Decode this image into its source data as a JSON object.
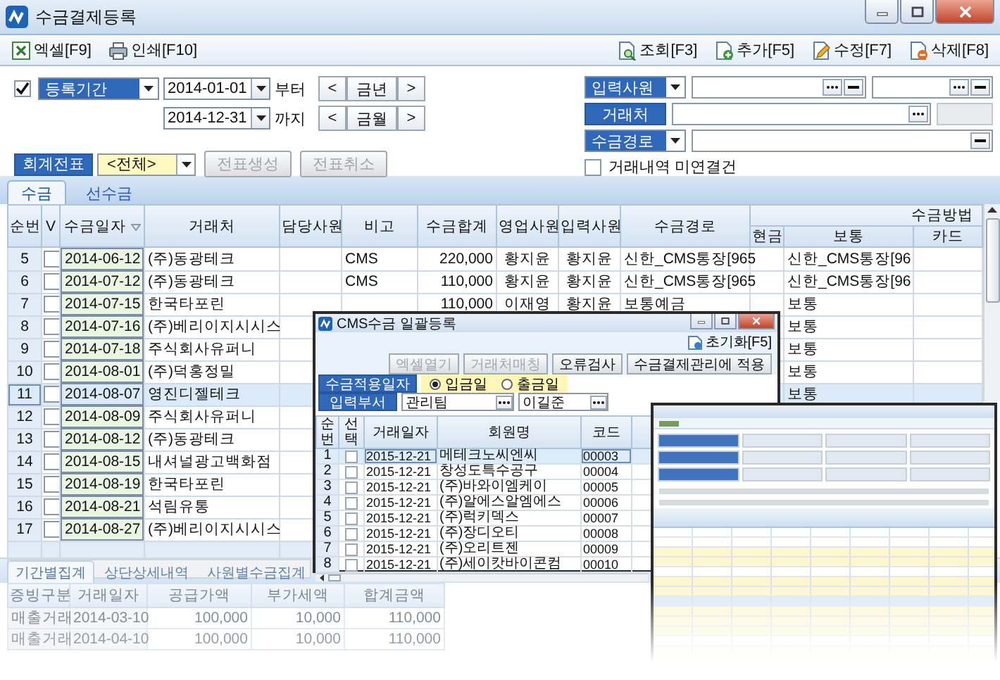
{
  "window": {
    "title": "수금결제등록"
  },
  "toolbar": {
    "left": [
      {
        "kind": "excel",
        "label": "엑셀[F9]"
      },
      {
        "kind": "print",
        "label": "인쇄[F10]"
      }
    ],
    "right": [
      {
        "kind": "search",
        "label": "조회[F3]"
      },
      {
        "kind": "add",
        "label": "추가[F5]"
      },
      {
        "kind": "edit",
        "label": "수정[F7]"
      },
      {
        "kind": "delete",
        "label": "삭제[F8]"
      }
    ]
  },
  "period": {
    "checked": true,
    "label": "등록기간",
    "from": "2014-01-01",
    "from_suffix": "부터",
    "to": "2014-12-31",
    "to_suffix": "까지",
    "year_nav": [
      "<",
      "금년",
      ">"
    ],
    "month_nav": [
      "<",
      "금월",
      ">"
    ]
  },
  "voucher": {
    "label": "회계전표",
    "value": "<전체>",
    "buttons": [
      {
        "label": "전표생성",
        "disabled": true
      },
      {
        "label": "전표취소",
        "disabled": true
      }
    ]
  },
  "staff": {
    "label": "입력사원"
  },
  "client": {
    "label": "거래처"
  },
  "route": {
    "label": "수금경로"
  },
  "unlinked": {
    "label": "거래내역 미연결건",
    "checked": false
  },
  "tabs": [
    {
      "label": "수금",
      "selected": true
    },
    {
      "label": "선수금",
      "selected": false
    }
  ],
  "grid": {
    "columns": [
      "순번",
      "V",
      "수금일자",
      "거래처",
      "담당사원",
      "비고",
      "수금합계",
      "영업사원",
      "입력사원",
      "수금경로"
    ],
    "method_group": {
      "label": "수금방법",
      "columns": [
        "현금",
        "보통",
        "카드"
      ]
    },
    "rows": [
      {
        "no": "5",
        "checked": false,
        "selected": false,
        "date": "2014-06-12",
        "client": "(주)동광테크",
        "memo": "CMS",
        "total": "220,000",
        "sales": "황지윤",
        "entry": "황지윤",
        "route": "신한_CMS통장[965",
        "ordinary": "신한_CMS통장[96"
      },
      {
        "no": "6",
        "checked": false,
        "selected": false,
        "date": "2014-07-12",
        "client": "(주)동광테크",
        "memo": "CMS",
        "total": "110,000",
        "sales": "황지윤",
        "entry": "황지윤",
        "route": "신한_CMS통장[965",
        "ordinary": "신한_CMS통장[96"
      },
      {
        "no": "7",
        "checked": false,
        "selected": false,
        "date": "2014-07-15",
        "client": "한국타포린",
        "total": "110,000",
        "sales": "이재영",
        "entry": "황지윤",
        "route": "보통예금",
        "ordinary": "보통"
      },
      {
        "no": "8",
        "checked": false,
        "selected": false,
        "date": "2014-07-16",
        "client": "(주)베리이지시시스",
        "ordinary": "보통"
      },
      {
        "no": "9",
        "checked": false,
        "selected": false,
        "date": "2014-07-18",
        "client": "주식회사유퍼니",
        "ordinary": "보통"
      },
      {
        "no": "10",
        "checked": false,
        "selected": false,
        "date": "2014-08-01",
        "client": "(주)덕홍정밀",
        "ordinary": "보통"
      },
      {
        "no": "11",
        "checked": false,
        "selected": true,
        "date": "2014-08-07",
        "client": "영진디젤테크",
        "ordinary": "보통"
      },
      {
        "no": "12",
        "checked": false,
        "selected": false,
        "date": "2014-08-09",
        "client": "주식회사유퍼니"
      },
      {
        "no": "13",
        "checked": false,
        "selected": false,
        "date": "2014-08-12",
        "client": "(주)동광테크"
      },
      {
        "no": "14",
        "checked": false,
        "selected": false,
        "date": "2014-08-15",
        "client": "내셔널광고백화점"
      },
      {
        "no": "15",
        "checked": false,
        "selected": false,
        "date": "2014-08-19",
        "client": "한국타포린"
      },
      {
        "no": "16",
        "checked": false,
        "selected": false,
        "date": "2014-08-21",
        "client": "석림유통"
      },
      {
        "no": "17",
        "checked": false,
        "selected": false,
        "date": "2014-08-27",
        "client": "(주)베리이지시시스"
      }
    ]
  },
  "summary_tabs": [
    {
      "label": "기간별집계",
      "selected": true
    },
    {
      "label": "상단상세내역",
      "selected": false
    },
    {
      "label": "사원별수금집계",
      "selected": false
    }
  ],
  "summary": {
    "columns": [
      "증빙구분",
      "거래일자",
      "공급가액",
      "부가세액",
      "합계금액"
    ],
    "rows": [
      [
        "매출거래",
        "2014-03-10",
        "100,000",
        "10,000",
        "110,000"
      ],
      [
        "매출거래",
        "2014-04-10",
        "100,000",
        "10,000",
        "110,000"
      ]
    ]
  },
  "cms_dialog": {
    "title": "CMS수금 일괄등록",
    "reset": "초기화[F5]",
    "buttons": [
      {
        "label": "엑셀열기",
        "disabled": true
      },
      {
        "label": "거래처매칭",
        "disabled": true
      },
      {
        "label": "오류검사",
        "disabled": false
      },
      {
        "label": "수금결제관리에 적용",
        "disabled": false
      }
    ],
    "date_type": {
      "label": "수금적용일자",
      "options": [
        {
          "label": "입금일",
          "selected": true
        },
        {
          "label": "출금일",
          "selected": false
        }
      ]
    },
    "dept": {
      "label": "입력부서",
      "value": "관리팀",
      "person": "이길준"
    },
    "columns": [
      "순번",
      "선택",
      "거래일자",
      "회원명",
      "코드"
    ],
    "rows": [
      {
        "no": "1",
        "checked": false,
        "selected": true,
        "date": "2015-12-21",
        "name": "메테크노씨엔씨",
        "code": "00003"
      },
      {
        "no": "2",
        "checked": false,
        "selected": false,
        "date": "2015-12-21",
        "name": "창성도특수공구",
        "code": "00004"
      },
      {
        "no": "3",
        "checked": false,
        "selected": false,
        "date": "2015-12-21",
        "name": "(주)바와이엠케이",
        "code": "00005"
      },
      {
        "no": "4",
        "checked": false,
        "selected": false,
        "date": "2015-12-21",
        "name": "(주)알에스알엠에스",
        "code": "00006"
      },
      {
        "no": "5",
        "checked": false,
        "selected": false,
        "date": "2015-12-21",
        "name": "(주)럭키덱스",
        "code": "00007"
      },
      {
        "no": "6",
        "checked": false,
        "selected": false,
        "date": "2015-12-21",
        "name": "(주)장디오티",
        "code": "00008"
      },
      {
        "no": "7",
        "checked": false,
        "selected": false,
        "date": "2015-12-21",
        "name": "(주)오리트젠",
        "code": "00009"
      },
      {
        "no": "8",
        "checked": false,
        "selected": false,
        "date": "2015-12-21",
        "name": "(주)세이캇바이콘컴",
        "code": "00010"
      }
    ]
  }
}
